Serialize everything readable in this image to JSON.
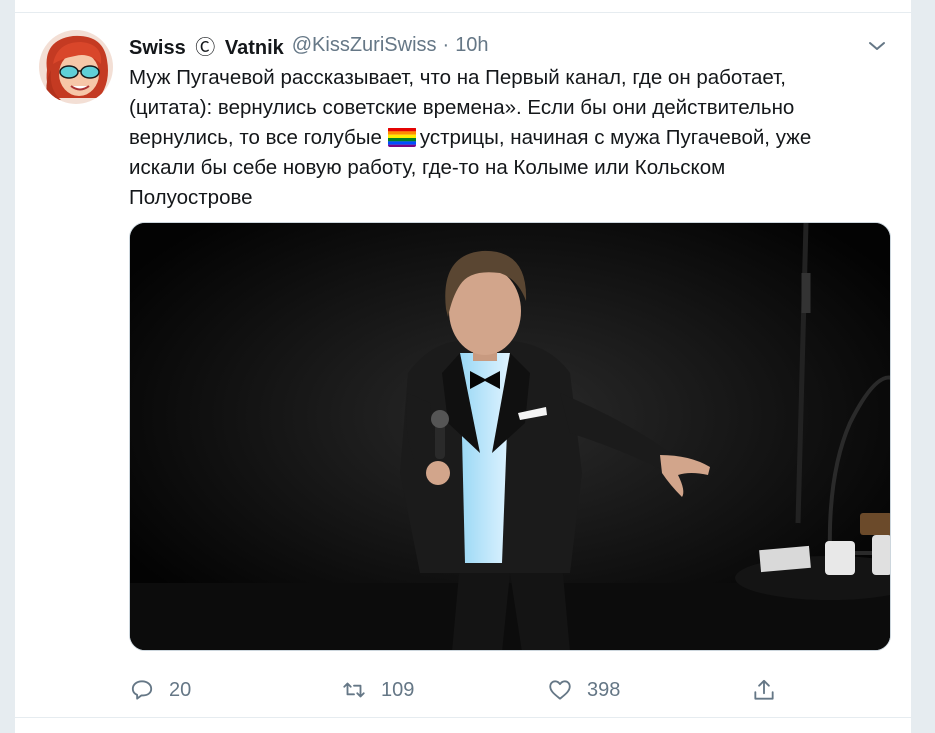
{
  "tweet": {
    "display_name_part1": "Swiss",
    "copyright_symbol": "Ⓒ",
    "display_name_part2": "Vatnik",
    "handle": "@KissZuriSwiss",
    "separator": "·",
    "timestamp": "10h",
    "text_lines": [
      "Муж Пугачевой рассказывает, что на Первый канал, где он работает,",
      "(цитата): вернулись советские времена». Если бы они действительно",
      "вернулись, то все голубые",
      "устрицы, начиная с мужа Пугачевой, уже",
      "искали бы себе новую работу, где-то на Колыме или Кольском",
      "Полуострове"
    ],
    "flag_emoji": "rainbow-flag",
    "media_description": "man-in-tuxedo-with-microphone-on-stage"
  },
  "actions": {
    "reply_count": "20",
    "retweet_count": "109",
    "like_count": "398"
  },
  "icons": {
    "avatar": "avatar-cartoon-woman-red-hair",
    "caret": "chevron-down-icon",
    "reply": "reply-icon",
    "retweet": "retweet-icon",
    "like": "heart-icon",
    "share": "share-icon"
  },
  "colors": {
    "text_primary": "#14171a",
    "text_secondary": "#657786",
    "border": "#e6ecf0"
  }
}
